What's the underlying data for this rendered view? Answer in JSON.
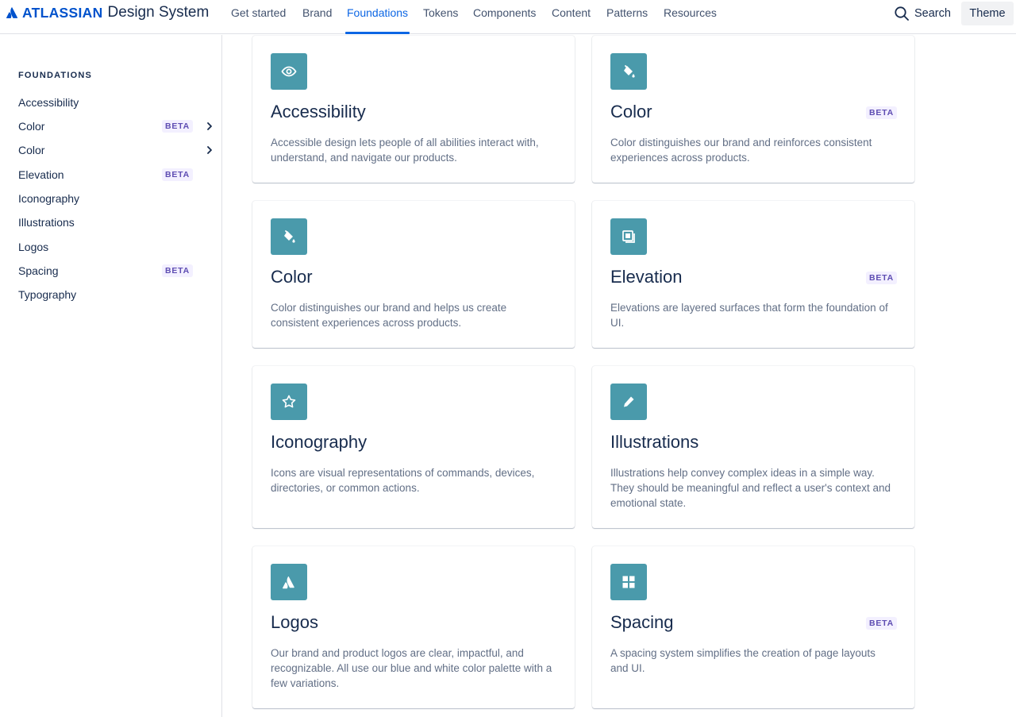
{
  "header": {
    "logo_word": "ATLASSIAN",
    "logo_suffix": "Design System",
    "nav": [
      "Get started",
      "Brand",
      "Foundations",
      "Tokens",
      "Components",
      "Content",
      "Patterns",
      "Resources"
    ],
    "active_nav": "Foundations",
    "search_label": "Search",
    "theme_label": "Theme"
  },
  "sidebar": {
    "heading": "FOUNDATIONS",
    "items": [
      {
        "label": "Accessibility",
        "badge": "",
        "chevron": false
      },
      {
        "label": "Color",
        "badge": "BETA",
        "chevron": true
      },
      {
        "label": "Color",
        "badge": "",
        "chevron": true
      },
      {
        "label": "Elevation",
        "badge": "BETA",
        "chevron": false
      },
      {
        "label": "Iconography",
        "badge": "",
        "chevron": false
      },
      {
        "label": "Illustrations",
        "badge": "",
        "chevron": false
      },
      {
        "label": "Logos",
        "badge": "",
        "chevron": false
      },
      {
        "label": "Spacing",
        "badge": "BETA",
        "chevron": false
      },
      {
        "label": "Typography",
        "badge": "",
        "chevron": false
      }
    ]
  },
  "cards": [
    {
      "title": "Accessibility",
      "badge": "",
      "icon": "eye-icon",
      "desc": "Accessible design lets people of all abilities interact with, understand, and navigate our products."
    },
    {
      "title": "Color",
      "badge": "BETA",
      "icon": "paint-bucket-icon",
      "desc": "Color distinguishes our brand and reinforces consistent experiences across products."
    },
    {
      "title": "Color",
      "badge": "",
      "icon": "paint-bucket-icon",
      "desc": "Color distinguishes our brand and helps us create consistent experiences across products."
    },
    {
      "title": "Elevation",
      "badge": "BETA",
      "icon": "layers-icon",
      "desc": "Elevations are layered surfaces that form the foundation of UI."
    },
    {
      "title": "Iconography",
      "badge": "",
      "icon": "star-icon",
      "desc": "Icons are visual representations of commands, devices, directories, or common actions."
    },
    {
      "title": "Illustrations",
      "badge": "",
      "icon": "pencil-icon",
      "desc": "Illustrations help convey complex ideas in a simple way. They should be meaningful and reflect a user's context and emotional state."
    },
    {
      "title": "Logos",
      "badge": "",
      "icon": "atlassian-logo-icon",
      "desc": "Our brand and product logos are clear, impactful, and recognizable. All use our blue and white color palette with a few variations."
    },
    {
      "title": "Spacing",
      "badge": "BETA",
      "icon": "grid-icon",
      "desc": "A spacing system simplifies the creation of page layouts and UI."
    }
  ],
  "colors": {
    "brand_blue": "#0052CC",
    "active_blue": "#0C66E4",
    "icon_tile": "#4A9AAB",
    "beta_text": "#5E4DB2",
    "beta_bg": "#F3F0FF"
  }
}
